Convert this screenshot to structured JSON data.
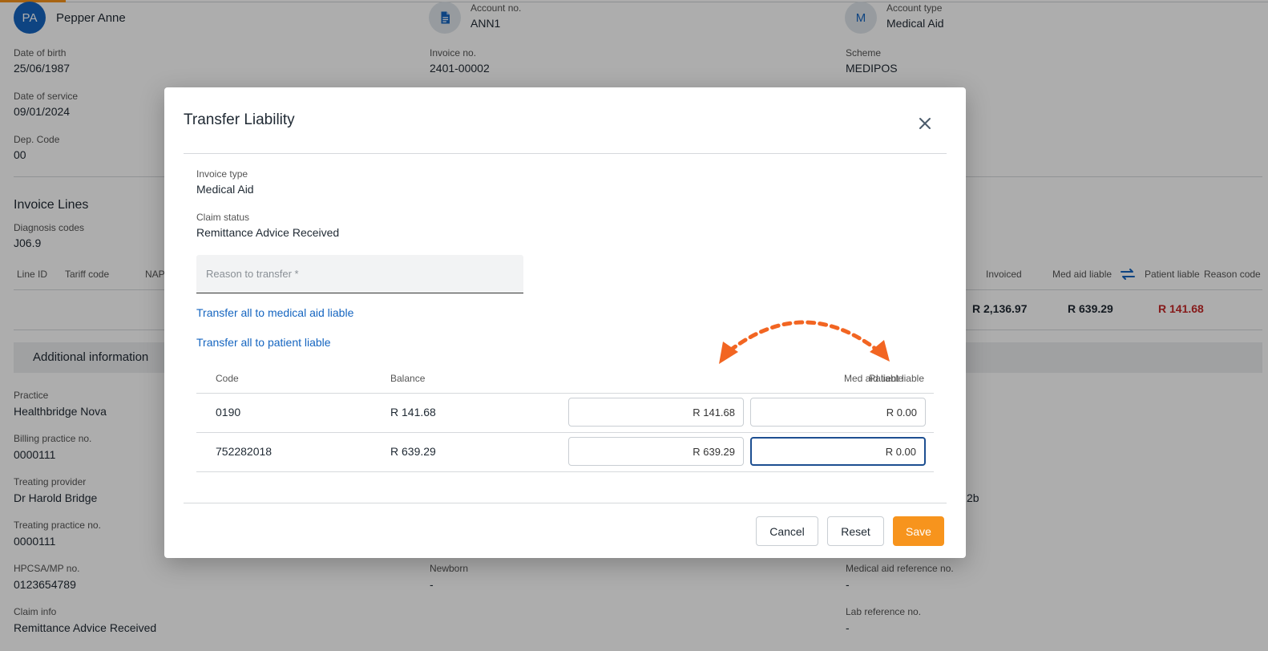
{
  "patient": {
    "initials": "PA",
    "name": "Pepper Anne",
    "account_no_label": "Account no.",
    "account_no": "ANN1",
    "account_type_initial": "M",
    "account_type_label": "Account type",
    "account_type": "Medical Aid",
    "dob_label": "Date of birth",
    "dob": "25/06/1987",
    "invoice_no_label": "Invoice no.",
    "invoice_no": "2401-00002",
    "scheme_label": "Scheme",
    "scheme": "MEDIPOS",
    "date_of_service_label": "Date of service",
    "date_of_service": "09/01/2024",
    "dep_code_label": "Dep. Code",
    "dep_code": "00"
  },
  "invoice_lines": {
    "title": "Invoice Lines",
    "diagnosis_label": "Diagnosis codes",
    "diagnosis": "J06.9",
    "columns": {
      "line_id": "Line ID",
      "tariff_code": "Tariff code",
      "nap": "NAP",
      "invoiced": "Invoiced",
      "med_aid_liable": "Med aid liable",
      "patient_liable": "Patient liable",
      "reason_code": "Reason code"
    },
    "totals": {
      "invoiced": "R 2,136.97",
      "med_aid_liable": "R 639.29",
      "patient_liable": "R 141.68"
    }
  },
  "additional": {
    "title": "Additional information",
    "practice_label": "Practice",
    "practice": "Healthbridge Nova",
    "billing_label": "Billing practice no.",
    "billing": "0000111",
    "treating_provider_label": "Treating provider",
    "treating_provider": "Dr Harold Bridge",
    "treating_practice_label": "Treating practice no.",
    "treating_practice": "0000111",
    "hpcsa_label": "HPCSA/MP no.",
    "hpcsa": "0123654789",
    "newborn_label": "Newborn",
    "newborn": "-",
    "med_ref_label": "Medical aid reference no.",
    "med_ref": "-",
    "claim_info_label": "Claim info",
    "claim_info": "Remittance Advice Received",
    "lab_ref_label": "Lab reference no.",
    "lab_ref": "-",
    "partial_value": "2b"
  },
  "modal": {
    "title": "Transfer Liability",
    "invoice_type_label": "Invoice type",
    "invoice_type": "Medical Aid",
    "claim_status_label": "Claim status",
    "claim_status": "Remittance Advice Received",
    "reason_placeholder": "Reason to transfer *",
    "link_med_aid": "Transfer all to medical aid liable",
    "link_patient": "Transfer all to patient liable",
    "columns": {
      "code": "Code",
      "balance": "Balance",
      "med_aid_liable": "Med aid liable",
      "patient_liable": "Patient liable"
    },
    "rows": [
      {
        "code": "0190",
        "balance": "R 141.68",
        "med_aid": "R 141.68",
        "patient": "R 0.00"
      },
      {
        "code": "752282018",
        "balance": "R 639.29",
        "med_aid": "R 639.29",
        "patient": "R 0.00"
      }
    ],
    "cancel_label": "Cancel",
    "reset_label": "Reset",
    "save_label": "Save"
  },
  "colors": {
    "accent": "#f7941d",
    "link": "#1565c0",
    "annotation_arrow": "#f26522",
    "negative": "#c62828"
  }
}
